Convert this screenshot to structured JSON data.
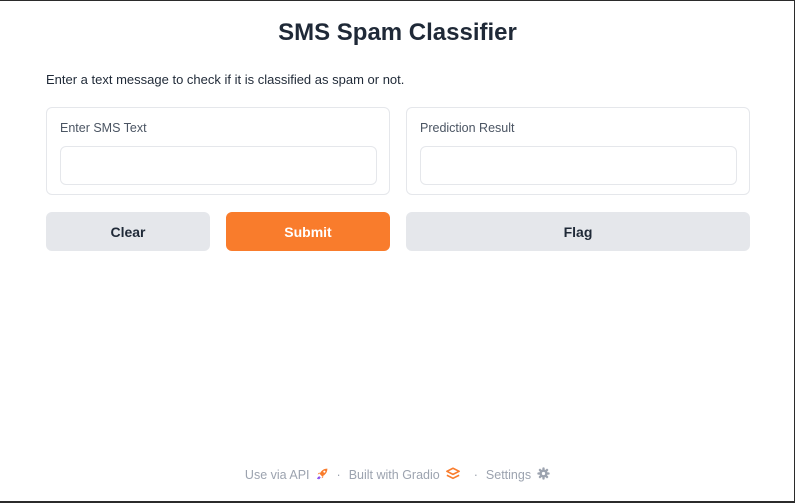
{
  "app": {
    "title": "SMS Spam Classifier",
    "description": "Enter a text message to check if it is classified as spam or not."
  },
  "inputs": {
    "sms": {
      "label": "Enter SMS Text",
      "value": ""
    }
  },
  "outputs": {
    "prediction": {
      "label": "Prediction Result",
      "value": ""
    }
  },
  "buttons": {
    "clear": "Clear",
    "submit": "Submit",
    "flag": "Flag"
  },
  "footer": {
    "api_link": "Use via API",
    "built_with": "Built with Gradio",
    "settings": "Settings",
    "separator": "·"
  },
  "colors": {
    "accent": "#f97c2c",
    "secondary_button": "#e5e7eb",
    "border": "#e5e7eb",
    "footer_text": "#9ca3af"
  },
  "icons": {
    "api": "rocket-icon",
    "gradio": "gradio-logo-icon",
    "settings": "gear-icon"
  }
}
